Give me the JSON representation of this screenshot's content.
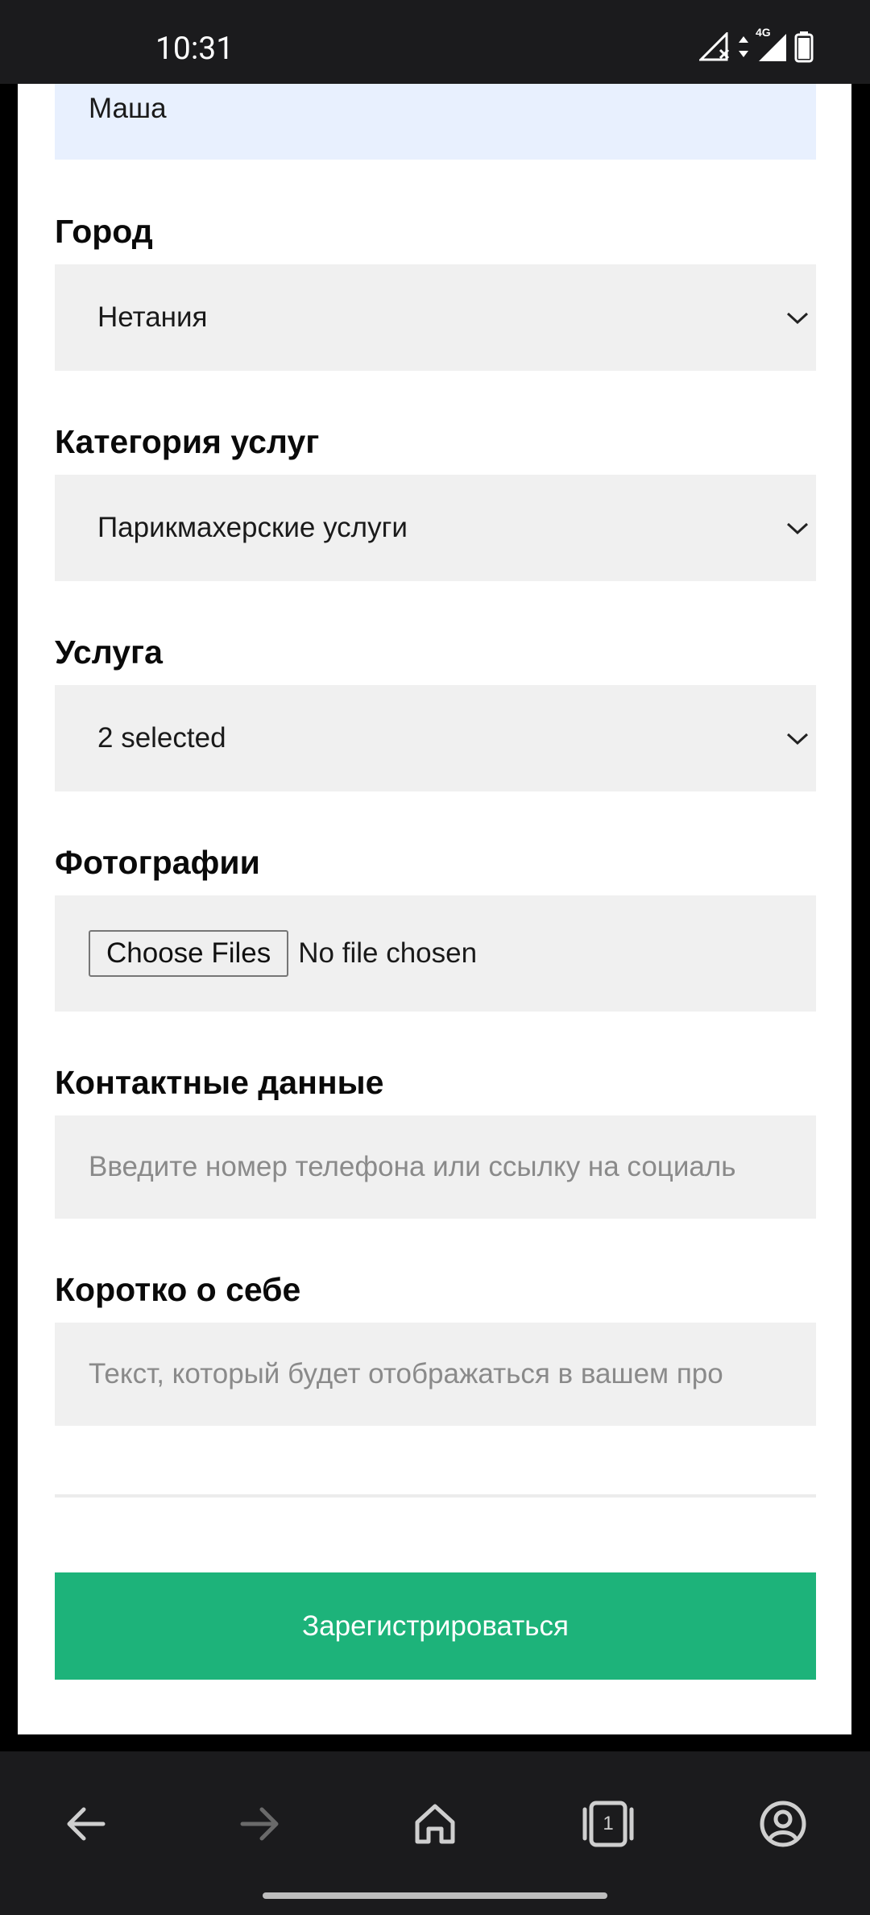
{
  "status_bar": {
    "time": "10:31",
    "network": "4G"
  },
  "form": {
    "name_value": "Маша",
    "city": {
      "label": "Город",
      "value": "Нетания"
    },
    "category": {
      "label": "Категория услуг",
      "value": "Парикмахерские услуги"
    },
    "service": {
      "label": "Услуга",
      "value": "2 selected"
    },
    "photos": {
      "label": "Фотографии",
      "button": "Choose Files",
      "status": "No file chosen"
    },
    "contacts": {
      "label": "Контактные данные",
      "placeholder": "Введите номер телефона или ссылку на социаль"
    },
    "about": {
      "label": "Коротко о себе",
      "placeholder": "Текст, который будет отображаться в вашем про"
    },
    "submit_label": "Зарегистрироваться"
  },
  "nav": {
    "tab_count": "1",
    "icons": [
      "back-icon",
      "forward-icon",
      "home-icon",
      "tabs-icon",
      "account-icon"
    ]
  },
  "colors": {
    "accent": "#1db37a",
    "field_bg": "#f0f0f0",
    "autofill_bg": "#e8f0fe"
  }
}
